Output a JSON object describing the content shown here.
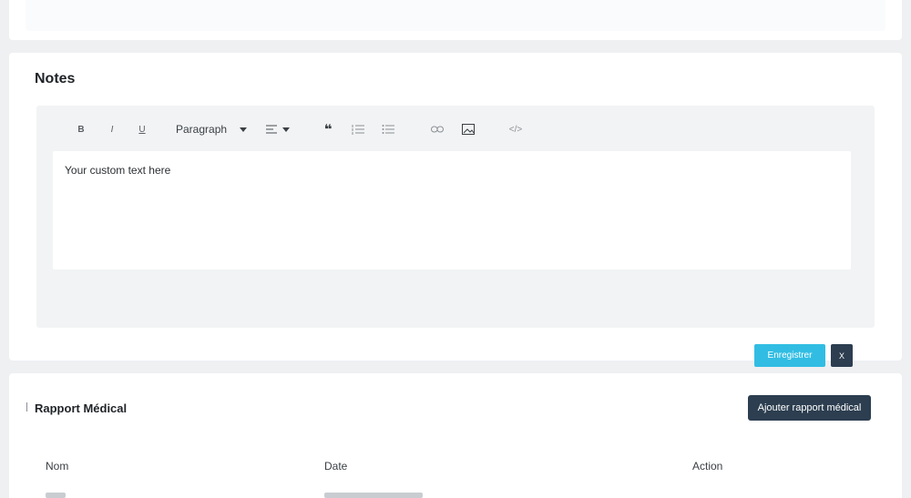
{
  "notes": {
    "title": "Notes",
    "toolbar": {
      "bold": "B",
      "italic": "I",
      "underline": "U",
      "block_format": "Paragraph",
      "icons": [
        "bold-icon",
        "italic-icon",
        "underline-icon",
        "align-left-icon",
        "blockquote-icon",
        "ordered-list-icon",
        "bullet-list-icon",
        "link-icon",
        "image-icon",
        "code-view-icon"
      ]
    },
    "content": "Your custom text here",
    "save_label": "Enregistrer",
    "small_button_label": "X"
  },
  "report": {
    "title": "Rapport Médical",
    "add_label": "Ajouter rapport médical",
    "columns": [
      "Nom",
      "Date",
      "Action"
    ]
  },
  "colors": {
    "accent": "#31bde3",
    "dark": "#2c3e50",
    "background": "#eef0f2"
  }
}
